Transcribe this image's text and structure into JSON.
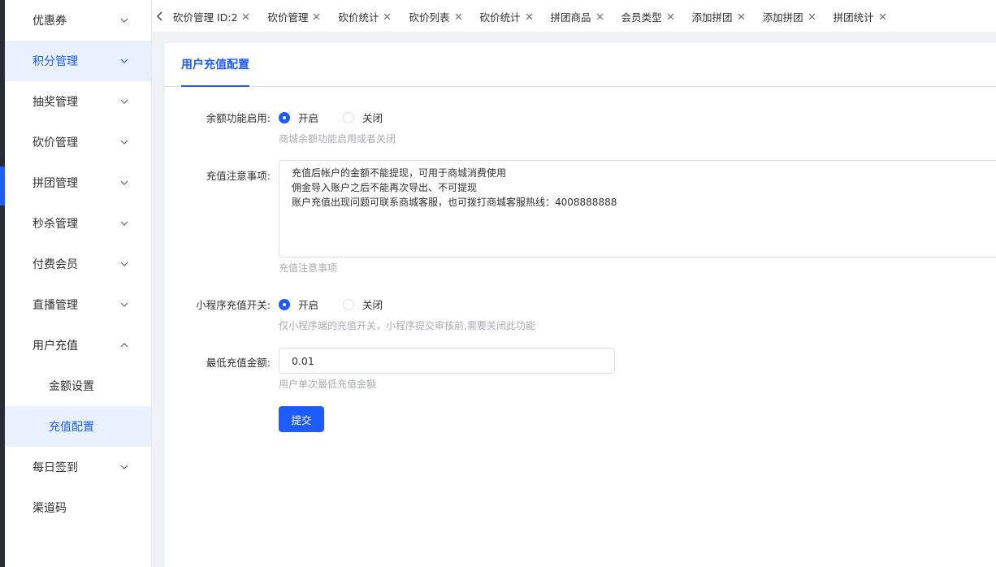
{
  "sidebar": {
    "items": [
      {
        "label": "优惠券"
      },
      {
        "label": "积分管理"
      },
      {
        "label": "抽奖管理"
      },
      {
        "label": "砍价管理"
      },
      {
        "label": "拼团管理"
      },
      {
        "label": "秒杀管理"
      },
      {
        "label": "付费会员"
      },
      {
        "label": "直播管理"
      },
      {
        "label": "用户充值"
      },
      {
        "label": "金额设置"
      },
      {
        "label": "充值配置"
      },
      {
        "label": "每日签到"
      },
      {
        "label": "渠道码"
      }
    ]
  },
  "tabs": [
    {
      "label": "砍价管理 ID:2"
    },
    {
      "label": "砍价管理"
    },
    {
      "label": "砍价统计"
    },
    {
      "label": "砍价列表"
    },
    {
      "label": "砍价统计"
    },
    {
      "label": "拼团商品"
    },
    {
      "label": "会员类型"
    },
    {
      "label": "添加拼团"
    },
    {
      "label": "添加拼团"
    },
    {
      "label": "拼团统计"
    }
  ],
  "page": {
    "tab_title": "用户充值配置"
  },
  "form": {
    "balance_label": "余额功能启用:",
    "balance_on": "开启",
    "balance_off": "关闭",
    "balance_help": "商城余额功能启用或者关闭",
    "notice_label": "充值注意事项:",
    "notice_value": "充值后帐户的金额不能提现，可用于商城消费使用\n佣金导入账户之后不能再次导出、不可提现\n账户充值出现问题可联系商城客服，也可拨打商城客服热线：4008888888",
    "notice_help": "充值注意事项",
    "mini_label": "小程序充值开关:",
    "mini_on": "开启",
    "mini_off": "关闭",
    "mini_help": "仅小程序端的充值开关，小程序提交审核前,需要关闭此功能",
    "min_label": "最低充值金额:",
    "min_value": "0.01",
    "min_help": "用户单次最低充值金额",
    "submit_label": "提交"
  },
  "colors": {
    "primary": "#1d5cff",
    "active_bg": "#e8f1fd",
    "help_text": "#a8abb2"
  }
}
